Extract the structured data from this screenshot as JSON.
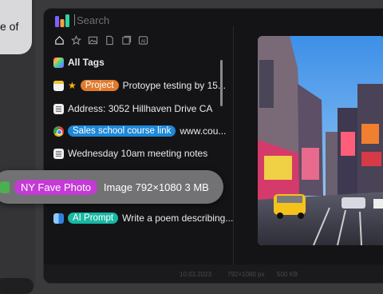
{
  "side": {
    "bubble_text": "e of"
  },
  "app": {
    "search_placeholder": "Search",
    "toolbar": [
      "home-icon",
      "star-icon",
      "image-icon",
      "document-icon",
      "stack-icon",
      "ai-icon"
    ],
    "toolbar_ai_label": "AI",
    "all_tags": "All Tags",
    "items": [
      {
        "tag": "Project",
        "text": "Protoype testing by 15...",
        "color": "#e07a2e"
      },
      {
        "text": "Address: 3052 Hillhaven Drive CA"
      },
      {
        "tag": "Sales school course link",
        "text": "www.cou...",
        "color": "#1e88d8"
      },
      {
        "text": "Wednesday 10am meeting notes"
      },
      {
        "tag": "AI Prompt",
        "text": "Write a poem describing...",
        "color": "#19b8a4"
      }
    ],
    "footer": {
      "date": "10.03.2023",
      "dims": "792×1080 px",
      "size": "500 KB"
    }
  },
  "floating": {
    "tag": "NY Fave Photo",
    "text": "Image 792×1080 3 MB",
    "tag_color": "#c43ad6"
  }
}
